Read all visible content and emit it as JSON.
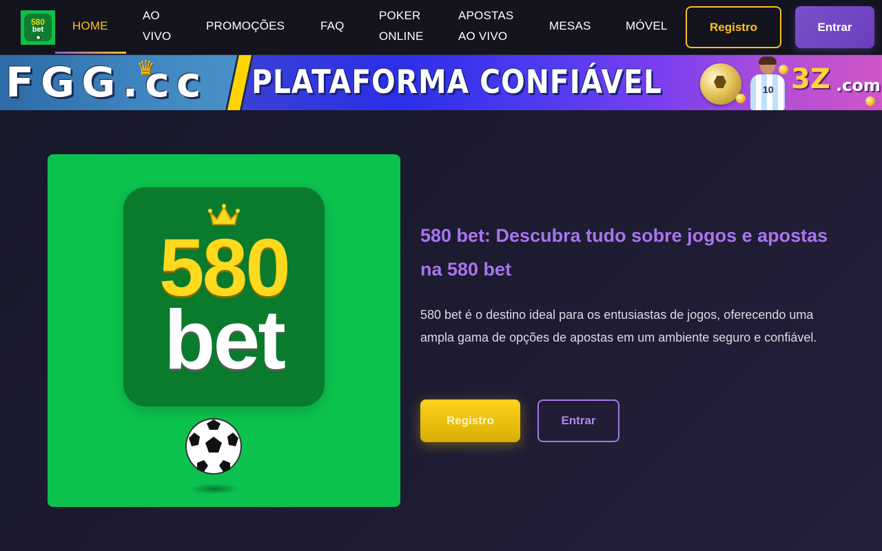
{
  "header": {
    "logo": {
      "number": "580",
      "word": "bet"
    },
    "nav": [
      {
        "line1": "HOME",
        "line2": ""
      },
      {
        "line1": "AO",
        "line2": "VIVO"
      },
      {
        "line1": "PROMOÇÕES",
        "line2": ""
      },
      {
        "line1": "FAQ",
        "line2": ""
      },
      {
        "line1": "POKER",
        "line2": "ONLINE"
      },
      {
        "line1": "APOSTAS",
        "line2": "AO VIVO"
      },
      {
        "line1": "MESAS",
        "line2": ""
      },
      {
        "line1": "MÓVEL",
        "line2": ""
      }
    ],
    "active_nav": "HOME",
    "register_label": "Registro",
    "login_label": "Entrar"
  },
  "banner": {
    "left_text": "FGG.cc",
    "main_text": "PLATAFORMA CONFIÁVEL",
    "brand_a": "3Z",
    "brand_b": ".com",
    "player_number": "10"
  },
  "hero": {
    "image": {
      "number": "580",
      "word": "bet"
    },
    "title": "580 bet: Descubra tudo sobre jogos e apostas na 580 bet",
    "description": "580 bet é o destino ideal para os entusiastas de jogos, oferecendo uma ampla gama de opções de apostas em um ambiente seguro e confiável.",
    "register_label": "Registro",
    "login_label": "Entrar"
  },
  "colors": {
    "accent_gold": "#ffc21c",
    "accent_purple": "#a875ef",
    "brand_green": "#0cc24e",
    "background": "#1c1b30"
  },
  "icons": [
    "crown-icon",
    "soccer-ball-icon"
  ]
}
